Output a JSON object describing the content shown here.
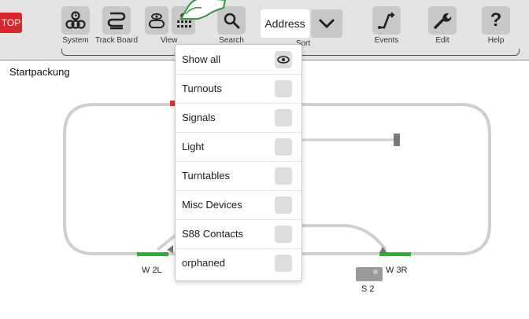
{
  "toolbar": {
    "stop_label": "TOP",
    "system_label": "System",
    "track_board_label": "Track Board",
    "view_label": "View",
    "search_label": "Search",
    "address_value": "Address",
    "sort_label": "Sort",
    "events_label": "Events",
    "edit_label": "Edit",
    "help_label": "Help",
    "help_glyph": "?"
  },
  "canvas": {
    "title": "Startpackung",
    "labels": {
      "w2l": "W 2L",
      "w3r": "W 3R",
      "s2": "S 2"
    }
  },
  "view_menu": {
    "items": [
      {
        "label": "Show all",
        "checked": true
      },
      {
        "label": "Turnouts",
        "checked": false
      },
      {
        "label": "Signals",
        "checked": false
      },
      {
        "label": "Light",
        "checked": false
      },
      {
        "label": "Turntables",
        "checked": false
      },
      {
        "label": "Misc Devices",
        "checked": false
      },
      {
        "label": "S88 Contacts",
        "checked": false
      },
      {
        "label": "orphaned",
        "checked": false
      }
    ]
  },
  "colors": {
    "stop_red": "#d8262b",
    "track_gray": "#cfcfcf",
    "turnout_green": "#2bb12b",
    "toolbar_bg": "#e3e3e3",
    "finger_green": "#2e9a3a"
  },
  "icons": {
    "stop": "stop-icon",
    "system": "system-icon",
    "track_board": "track-board-icon",
    "view": "eye-icon",
    "search": "search-icon",
    "sort": "chevron-down-icon",
    "events": "events-icon",
    "edit": "wrench-icon",
    "help": "help-icon"
  }
}
